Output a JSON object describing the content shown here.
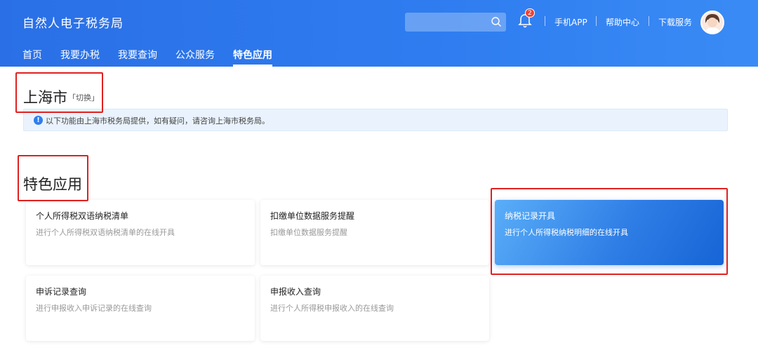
{
  "header": {
    "site_title": "自然人电子税务局",
    "search_placeholder": "",
    "notification_count": "2",
    "links": {
      "mobile_app": "手机APP",
      "help_center": "帮助中心",
      "download_service": "下载服务"
    },
    "nav": [
      "首页",
      "我要办税",
      "我要查询",
      "公众服务",
      "特色应用"
    ],
    "active_nav": "特色应用"
  },
  "city": {
    "name": "上海市",
    "switch_label": "「切换」",
    "notice": "以下功能由上海市税务局提供，如有疑问，请咨询上海市税务局。"
  },
  "section": {
    "title": "特色应用"
  },
  "cards": [
    {
      "title": "个人所得税双语纳税清单",
      "desc": "进行个人所得税双语纳税清单的在线开具"
    },
    {
      "title": "扣缴单位数据服务提醒",
      "desc": "扣缴单位数据服务提醒"
    },
    {
      "title": "纳税记录开具",
      "desc": "进行个人所得税纳税明细的在线开具"
    },
    {
      "title": "申诉记录查询",
      "desc": "进行申报收入申诉记录的在线查询"
    },
    {
      "title": "申报收入查询",
      "desc": "进行个人所得税申报收入的在线查询"
    }
  ],
  "colors": {
    "brand": "#2f7df0",
    "annotation": "#e02020",
    "badge": "#f04134"
  },
  "icons": [
    "search-icon",
    "bell-icon",
    "avatar",
    "info-icon"
  ]
}
